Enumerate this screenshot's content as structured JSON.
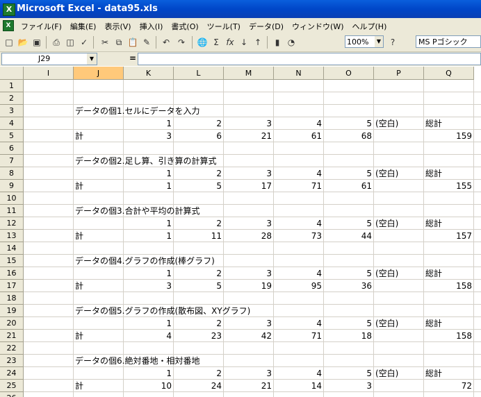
{
  "window": {
    "title": "Microsoft Excel - data95.xls",
    "app_icon": "X"
  },
  "menubar": {
    "doc_icon": "X",
    "items": [
      "ファイル(F)",
      "編集(E)",
      "表示(V)",
      "挿入(I)",
      "書式(O)",
      "ツール(T)",
      "データ(D)",
      "ウィンドウ(W)",
      "ヘルプ(H)"
    ]
  },
  "toolbar": {
    "icons": [
      "new-icon",
      "open-icon",
      "save-icon",
      "print-icon",
      "print-preview-icon",
      "spellcheck-icon",
      "cut-icon",
      "copy-icon",
      "paste-icon",
      "format-painter-icon",
      "undo-icon",
      "redo-icon",
      "hyperlink-icon",
      "autosum-icon",
      "function-icon",
      "sort-ascending-icon",
      "sort-descending-icon",
      "chart-wizard-icon",
      "drawing-icon",
      "help-icon"
    ],
    "zoom": "100%",
    "font": "MS Pゴシック"
  },
  "formula_bar": {
    "name_box": "J29",
    "equals": "=",
    "formula": ""
  },
  "columns": [
    "I",
    "J",
    "K",
    "L",
    "M",
    "N",
    "O",
    "P",
    "Q"
  ],
  "selected_column": "J",
  "rows": [
    "1",
    "2",
    "3",
    "4",
    "5",
    "6",
    "7",
    "8",
    "9",
    "10",
    "11",
    "12",
    "13",
    "14",
    "15",
    "16",
    "17",
    "18",
    "19",
    "20",
    "21",
    "22",
    "23",
    "24",
    "25",
    "26"
  ],
  "sections": [
    {
      "title": "データの個1.セルにデータを入力",
      "headers": [
        "1",
        "2",
        "3",
        "4",
        "5",
        "(空白)",
        "総計"
      ],
      "total_label": "計",
      "values": [
        "3",
        "6",
        "21",
        "61",
        "68",
        "",
        "159"
      ]
    },
    {
      "title": "データの個2.足し算、引き算の計算式",
      "headers": [
        "1",
        "2",
        "3",
        "4",
        "5",
        "(空白)",
        "総計"
      ],
      "total_label": "計",
      "values": [
        "1",
        "5",
        "17",
        "71",
        "61",
        "",
        "155"
      ]
    },
    {
      "title": "データの個3.合計や平均の計算式",
      "headers": [
        "1",
        "2",
        "3",
        "4",
        "5",
        "(空白)",
        "総計"
      ],
      "total_label": "計",
      "values": [
        "1",
        "11",
        "28",
        "73",
        "44",
        "",
        "157"
      ]
    },
    {
      "title": "データの個4.グラフの作成(棒グラフ)",
      "headers": [
        "1",
        "2",
        "3",
        "4",
        "5",
        "(空白)",
        "総計"
      ],
      "total_label": "計",
      "values": [
        "3",
        "5",
        "19",
        "95",
        "36",
        "",
        "158"
      ]
    },
    {
      "title": "データの個5.グラフの作成(散布図、XYグラフ)",
      "headers": [
        "1",
        "2",
        "3",
        "4",
        "5",
        "(空白)",
        "総計"
      ],
      "total_label": "計",
      "values": [
        "4",
        "23",
        "42",
        "71",
        "18",
        "",
        "158"
      ]
    },
    {
      "title": "データの個6.絶対番地・相対番地",
      "headers": [
        "1",
        "2",
        "3",
        "4",
        "5",
        "(空白)",
        "総計"
      ],
      "total_label": "計",
      "values": [
        "10",
        "24",
        "21",
        "14",
        "3",
        "",
        "72"
      ]
    }
  ]
}
